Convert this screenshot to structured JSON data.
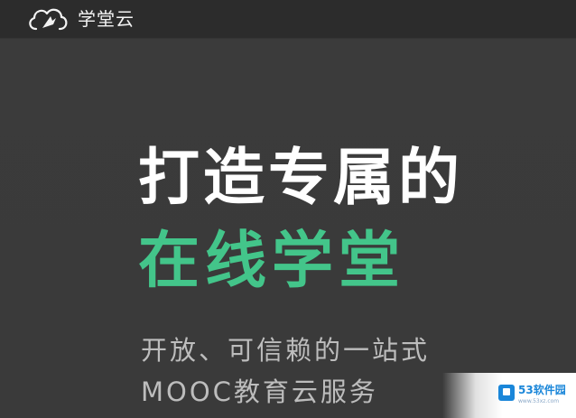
{
  "header": {
    "logo_icon": "cloud-rocket-icon",
    "logo_text": "学堂云"
  },
  "hero": {
    "headline": "打造专属的",
    "headline_accent": "在线学堂",
    "subline_1": "开放、可信赖的一站式",
    "subline_2": "MOOC教育云服务"
  },
  "watermark": {
    "logo_icon": "square-logo-icon",
    "text": "53软件园",
    "subtext": "www.53xz.com"
  },
  "colors": {
    "background": "#3a3a3a",
    "accent": "#43c58a",
    "headline": "#ffffff",
    "subline": "#bdbdbd"
  }
}
